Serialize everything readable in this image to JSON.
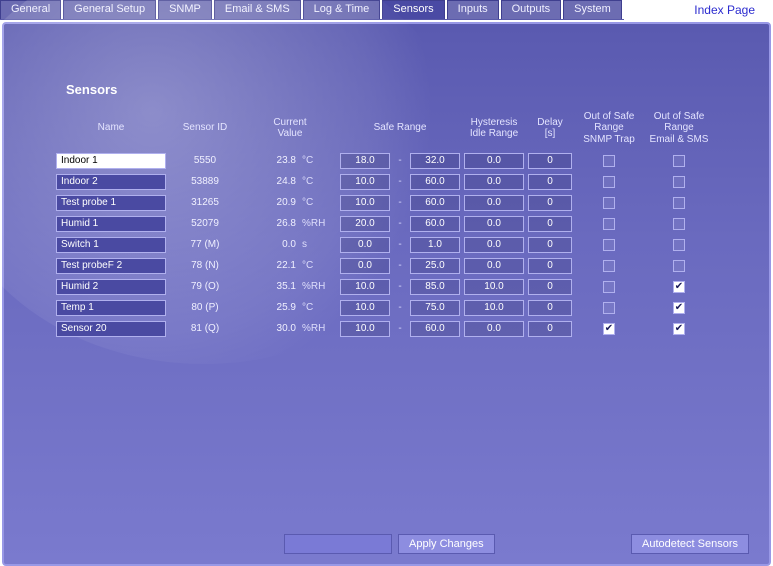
{
  "index_link": "Index Page",
  "tabs": [
    {
      "label": "General"
    },
    {
      "label": "General Setup"
    },
    {
      "label": "SNMP"
    },
    {
      "label": "Email & SMS"
    },
    {
      "label": "Log & Time"
    },
    {
      "label": "Sensors",
      "active": true
    },
    {
      "label": "Inputs"
    },
    {
      "label": "Outputs"
    },
    {
      "label": "System"
    }
  ],
  "panel": {
    "title": "Sensors"
  },
  "columns": {
    "name": "Name",
    "sensor_id": "Sensor ID",
    "current_value": "Current\nValue",
    "safe_range": "Safe Range",
    "hysteresis": "Hysteresis\nIdle Range",
    "delay": "Delay\n[s]",
    "snmp": "Out of Safe\nRange\nSNMP Trap",
    "email": "Out of Safe\nRange\nEmail & SMS"
  },
  "rows": [
    {
      "name": "Indoor 1",
      "name_inverse": true,
      "sensor_id": "5550",
      "value": "23.8",
      "unit": "°C",
      "lo": "18.0",
      "hi": "32.0",
      "hyst": "0.0",
      "delay": "0",
      "snmp": false,
      "email": false
    },
    {
      "name": "Indoor 2",
      "sensor_id": "53889",
      "value": "24.8",
      "unit": "°C",
      "lo": "10.0",
      "hi": "60.0",
      "hyst": "0.0",
      "delay": "0",
      "snmp": false,
      "email": false
    },
    {
      "name": "Test probe 1",
      "sensor_id": "31265",
      "value": "20.9",
      "unit": "°C",
      "lo": "10.0",
      "hi": "60.0",
      "hyst": "0.0",
      "delay": "0",
      "snmp": false,
      "email": false
    },
    {
      "name": "Humid 1",
      "sensor_id": "52079",
      "value": "26.8",
      "unit": "%RH",
      "lo": "20.0",
      "hi": "60.0",
      "hyst": "0.0",
      "delay": "0",
      "snmp": false,
      "email": false
    },
    {
      "name": "Switch 1",
      "sensor_id": "77 (M)",
      "value": "0.0",
      "unit": "s",
      "lo": "0.0",
      "hi": "1.0",
      "hyst": "0.0",
      "delay": "0",
      "snmp": false,
      "email": false
    },
    {
      "name": "Test probeF 2",
      "sensor_id": "78 (N)",
      "value": "22.1",
      "unit": "°C",
      "lo": "0.0",
      "hi": "25.0",
      "hyst": "0.0",
      "delay": "0",
      "snmp": false,
      "email": false
    },
    {
      "name": "Humid 2",
      "sensor_id": "79 (O)",
      "value": "35.1",
      "unit": "%RH",
      "lo": "10.0",
      "hi": "85.0",
      "hyst": "10.0",
      "delay": "0",
      "snmp": false,
      "email": true
    },
    {
      "name": "Temp 1",
      "sensor_id": "80 (P)",
      "value": "25.9",
      "unit": "°C",
      "lo": "10.0",
      "hi": "75.0",
      "hyst": "10.0",
      "delay": "0",
      "snmp": false,
      "email": true
    },
    {
      "name": "Sensor 20",
      "sensor_id": "81 (Q)",
      "value": "30.0",
      "unit": "%RH",
      "lo": "10.0",
      "hi": "60.0",
      "hyst": "0.0",
      "delay": "0",
      "snmp": true,
      "email": true
    }
  ],
  "buttons": {
    "apply": "Apply Changes",
    "autodetect": "Autodetect Sensors"
  }
}
